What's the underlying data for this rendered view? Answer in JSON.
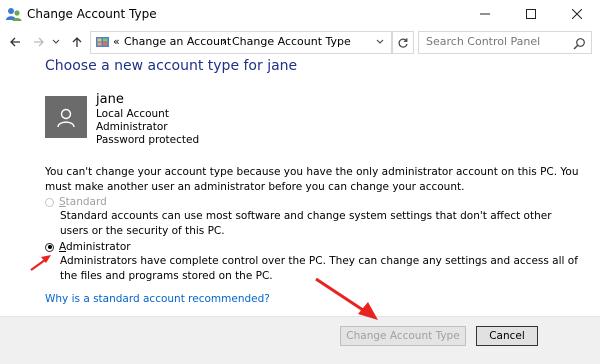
{
  "window": {
    "title": "Change Account Type",
    "icon": "users-control-panel-icon"
  },
  "addressbar": {
    "chevrons": "«",
    "crumb1": "Change an Account",
    "separator": "›",
    "crumb2": "Change Account Type",
    "search_placeholder": "Search Control Panel"
  },
  "content": {
    "heading": "Choose a new account type for jane",
    "user": {
      "name": "jane",
      "line1": "Local Account",
      "line2": "Administrator",
      "line3": "Password protected"
    },
    "notice": "You can't change your account type because you have the only administrator account on this PC. You must make another user an administrator before you can change your account.",
    "standard": {
      "label_initial": "S",
      "label_rest": "tandard",
      "description": "Standard accounts can use most software and change system settings that don't affect other users or the security of this PC."
    },
    "administrator": {
      "label_initial": "A",
      "label_rest": "dministrator",
      "description": "Administrators have complete control over the PC. They can change any settings and access all of the files and programs stored on the PC."
    },
    "link": "Why is a standard account recommended?"
  },
  "buttons": {
    "change": "Change Account Type",
    "cancel": "Cancel"
  },
  "colors": {
    "heading": "#1e3287",
    "link": "#0066cc",
    "annotation_arrow": "#e8231f",
    "avatar": "#6b6b6b"
  }
}
